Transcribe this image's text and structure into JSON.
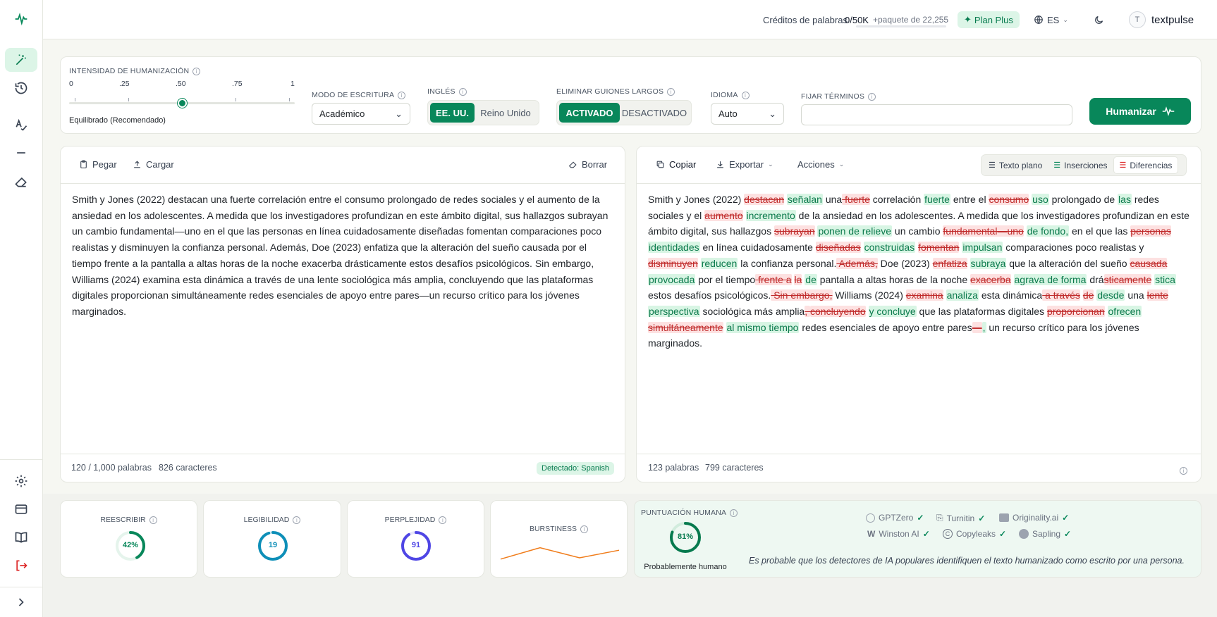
{
  "topbar": {
    "credits_label": "Créditos de palabras",
    "credits_value": "0/50K",
    "package_label": "+paquete de 22,255",
    "plan_label": "Plan Plus",
    "language": "ES",
    "username": "textpulse",
    "avatar_initial": "T"
  },
  "settings": {
    "intensity_label": "INTENSIDAD DE HUMANIZACIÓN",
    "ticks": [
      "0",
      ".25",
      ".50",
      ".75",
      "1"
    ],
    "intensity_value": 0.5,
    "intensity_caption": "Equilibrado (Recomendado)",
    "mode_label": "MODO DE ESCRITURA",
    "mode_value": "Académico",
    "english_label": "INGLÉS",
    "english_options": [
      "EE. UU.",
      "Reino Unido"
    ],
    "dash_label": "ELIMINAR GUIONES LARGOS",
    "dash_options": [
      "ACTIVADO",
      "DESACTIVADO"
    ],
    "lang_label": "IDIOMA",
    "lang_value": "Auto",
    "terms_label": "FIJAR TÉRMINOS",
    "terms_value": "",
    "humanize_label": "Humanizar"
  },
  "input_panel": {
    "paste_label": "Pegar",
    "upload_label": "Cargar",
    "clear_label": "Borrar",
    "text": "Smith y Jones (2022) destacan una fuerte correlación entre el consumo prolongado de redes sociales y el aumento de la ansiedad en los adolescentes. A medida que los investigadores profundizan en este ámbito digital, sus hallazgos subrayan un cambio fundamental—uno en el que las personas en línea cuidadosamente diseñadas fomentan comparaciones poco realistas y disminuyen la confianza personal. Además, Doe (2023) enfatiza que la alteración del sueño causada por el tiempo frente a la pantalla a altas horas de la noche exacerba drásticamente estos desafíos psicológicos. Sin embargo, Williams (2024) examina esta dinámica a través de una lente sociológica más amplia, concluyendo que las plataformas digitales proporcionan simultáneamente redes esenciales de apoyo entre pares—un recurso crítico para los jóvenes marginados.",
    "word_count": "120 / 1,000 palabras",
    "char_count": "826 caracteres",
    "detected": "Detectado: Spanish"
  },
  "output_panel": {
    "copy_label": "Copiar",
    "export_label": "Exportar",
    "actions_label": "Acciones",
    "view_tabs": [
      "Texto plano",
      "Inserciones",
      "Diferencias"
    ],
    "word_count": "123 palabras",
    "char_count": "799 caracteres",
    "diff": [
      [
        "t",
        "Smith y Jones (2022) "
      ],
      [
        "d",
        "destacan"
      ],
      [
        "t",
        " "
      ],
      [
        "i",
        "señalan"
      ],
      [
        "t",
        " una"
      ],
      [
        "d",
        " fuerte"
      ],
      [
        "t",
        " correlación "
      ],
      [
        "i",
        "fuerte"
      ],
      [
        "t",
        " entre el "
      ],
      [
        "d",
        "consumo"
      ],
      [
        "t",
        " "
      ],
      [
        "i",
        "uso"
      ],
      [
        "t",
        " prolongado de "
      ],
      [
        "i",
        "las"
      ],
      [
        "t",
        " redes sociales y el "
      ],
      [
        "d",
        "aumento"
      ],
      [
        "t",
        " "
      ],
      [
        "i",
        "incremento"
      ],
      [
        "t",
        " de la ansiedad en los adolescentes. A medida que los investigadores profundizan en este ámbito digital, sus hallazgos "
      ],
      [
        "d",
        "subrayan"
      ],
      [
        "t",
        " "
      ],
      [
        "i",
        "ponen de relieve"
      ],
      [
        "t",
        " un cambio "
      ],
      [
        "d",
        "fundamental—uno"
      ],
      [
        "t",
        " "
      ],
      [
        "i",
        "de fondo,"
      ],
      [
        "t",
        " en el que las "
      ],
      [
        "d",
        "personas"
      ],
      [
        "t",
        " "
      ],
      [
        "i",
        "identidades"
      ],
      [
        "t",
        " en línea cuidadosamente "
      ],
      [
        "d",
        "diseñadas"
      ],
      [
        "t",
        " "
      ],
      [
        "i",
        "construidas"
      ],
      [
        "t",
        " "
      ],
      [
        "d",
        "fomentan"
      ],
      [
        "t",
        " "
      ],
      [
        "i",
        "impulsan"
      ],
      [
        "t",
        " comparaciones poco realistas y "
      ],
      [
        "d",
        "disminuyen"
      ],
      [
        "t",
        " "
      ],
      [
        "i",
        "reducen"
      ],
      [
        "t",
        " la confianza personal."
      ],
      [
        "d",
        " Además,"
      ],
      [
        "t",
        " Doe (2023) "
      ],
      [
        "d",
        "enfatiza"
      ],
      [
        "t",
        " "
      ],
      [
        "i",
        "subraya"
      ],
      [
        "t",
        " que la alteración del sueño "
      ],
      [
        "d",
        "causada"
      ],
      [
        "t",
        " "
      ],
      [
        "i",
        "provocada"
      ],
      [
        "t",
        " por el tiempo"
      ],
      [
        "d",
        " frente a"
      ],
      [
        "t",
        " "
      ],
      [
        "d",
        "la"
      ],
      [
        "t",
        " "
      ],
      [
        "i",
        "de"
      ],
      [
        "t",
        " pantalla a altas horas de la noche "
      ],
      [
        "d",
        "exacerba"
      ],
      [
        "t",
        " "
      ],
      [
        "i",
        "agrava de forma"
      ],
      [
        "t",
        " drá"
      ],
      [
        "d",
        "sticamente"
      ],
      [
        "t",
        " "
      ],
      [
        "i",
        "stica"
      ],
      [
        "t",
        " estos desafíos psicológicos."
      ],
      [
        "d",
        " Sin embargo,"
      ],
      [
        "t",
        " Williams (2024) "
      ],
      [
        "d",
        "examina"
      ],
      [
        "t",
        " "
      ],
      [
        "i",
        "analiza"
      ],
      [
        "t",
        " esta dinámica"
      ],
      [
        "d",
        " a través"
      ],
      [
        "t",
        " "
      ],
      [
        "d",
        "de"
      ],
      [
        "t",
        " "
      ],
      [
        "i",
        "desde"
      ],
      [
        "t",
        " una "
      ],
      [
        "d",
        "lente"
      ],
      [
        "t",
        " "
      ],
      [
        "i",
        "perspectiva"
      ],
      [
        "t",
        " sociológica más amplia"
      ],
      [
        "d",
        ", "
      ],
      [
        "d",
        "concluyendo"
      ],
      [
        "t",
        " "
      ],
      [
        "i",
        "y concluye"
      ],
      [
        "t",
        " que las plataformas digitales "
      ],
      [
        "d",
        "proporcionan"
      ],
      [
        "t",
        " "
      ],
      [
        "i",
        "ofrecen"
      ],
      [
        "t",
        " "
      ],
      [
        "d",
        "simultáneamente"
      ],
      [
        "t",
        " "
      ],
      [
        "i",
        "al mismo tiempo"
      ],
      [
        "t",
        " redes esenciales de apoyo entre pares"
      ],
      [
        "d",
        "—"
      ],
      [
        "i",
        ","
      ],
      [
        "t",
        " un recurso crítico para los jóvenes marginados."
      ]
    ]
  },
  "metrics": {
    "rewrite_label": "REESCRIBIR",
    "rewrite_value": "42%",
    "rewrite_fraction": 0.42,
    "readability_label": "LEGIBILIDAD",
    "readability_value": "19",
    "readability_fraction": 0.95,
    "perplexity_label": "PERPLEJIDAD",
    "perplexity_value": "91",
    "perplexity_fraction": 0.91,
    "burstiness_label": "BURSTINESS",
    "burstiness_points": [
      0.2,
      0.65,
      0.25,
      0.55
    ],
    "human_label": "PUNTUACIÓN HUMANA",
    "human_value": "81%",
    "human_fraction": 0.81,
    "human_caption": "Probablemente humano",
    "detectors": [
      "GPTZero",
      "Turnitin",
      "Originality.ai",
      "Winston AI",
      "Copyleaks",
      "Sapling"
    ],
    "detector_note": "Es probable que los detectores de IA populares identifiquen el texto humanizado como escrito por una persona."
  },
  "colors": {
    "accent": "#08875a",
    "readability": "#0e8fb8",
    "perplexity": "#4f46e5",
    "burstiness": "#f07c1a"
  }
}
